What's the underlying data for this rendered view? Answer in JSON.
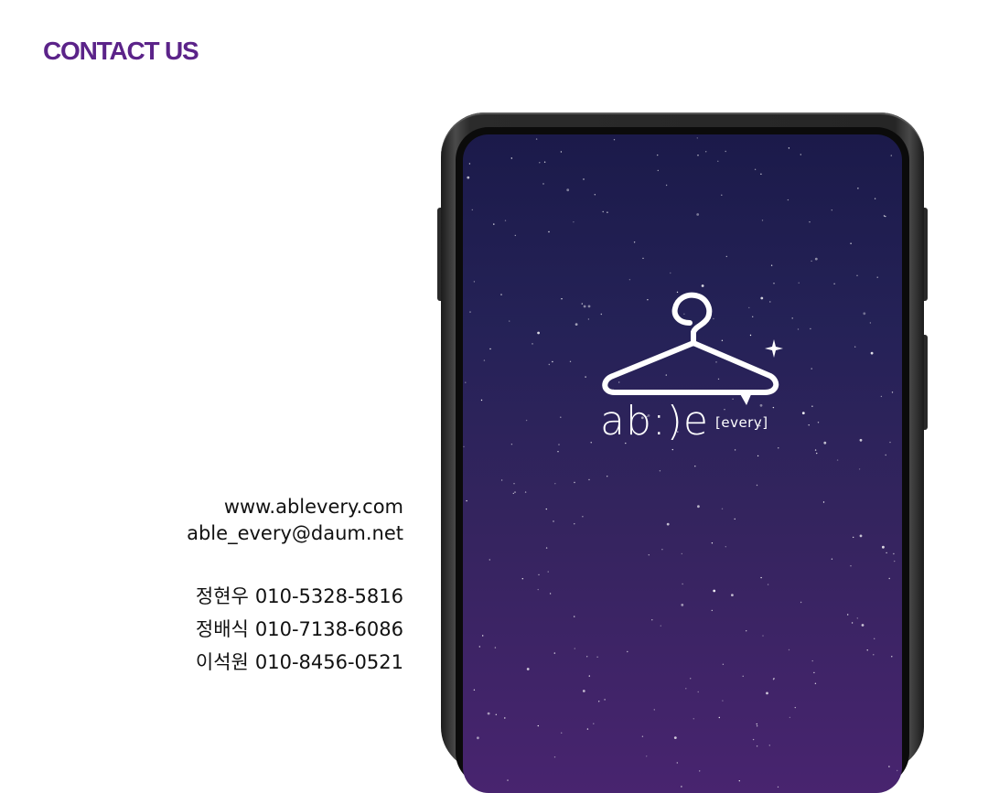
{
  "heading": "CONTACT US",
  "contact": {
    "website": "www.ablevery.com",
    "email": "able_every@daum.net",
    "people": [
      {
        "name": "정현우",
        "phone": "010-5328-5816"
      },
      {
        "name": "정배식",
        "phone": "010-7138-6086"
      },
      {
        "name": "이석원",
        "phone": "010-8456-0521"
      }
    ]
  },
  "app_logo": {
    "wordmark": "ab:)e",
    "sub": "[every]",
    "icon": "hanger-icon"
  },
  "colors": {
    "heading": "#5b2389",
    "screen_top": "#1b1a4a",
    "screen_bottom": "#48246f"
  }
}
